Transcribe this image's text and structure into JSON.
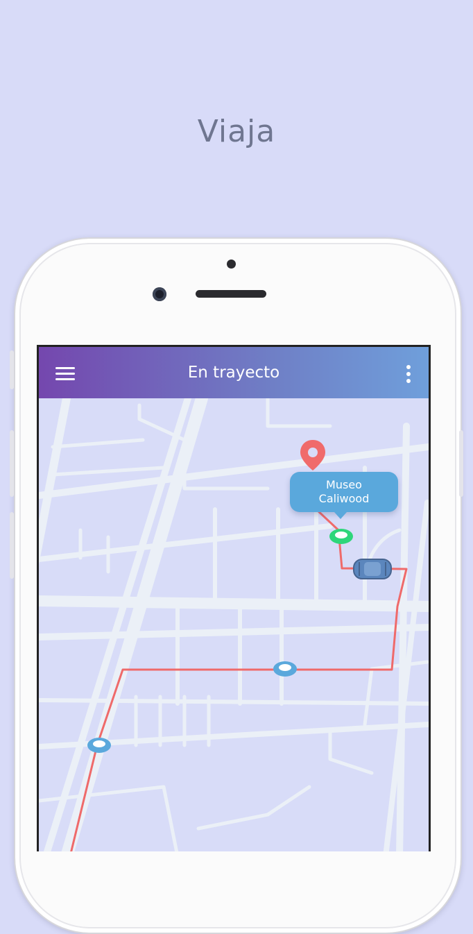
{
  "headline": "Viaja",
  "appbar": {
    "title": "En trayecto",
    "menu_icon": "hamburger-menu-icon",
    "overflow_icon": "more-vert-icon"
  },
  "map": {
    "destination_name_line1": "Museo",
    "destination_name_line2": "Caliwood",
    "colors": {
      "route": "#ef6a6a",
      "callout": "#5aa8dc",
      "current_stop": "#2ed67a",
      "waypoint": "#5aa8dc",
      "destination_pin": "#f06b6b",
      "vehicle": "#5b86bd",
      "map_background": "#d8dcf8",
      "streets": "#ebf0f7"
    },
    "icons": {
      "destination": "location-pin-icon",
      "vehicle": "car-icon",
      "waypoint": "waypoint-icon"
    }
  }
}
